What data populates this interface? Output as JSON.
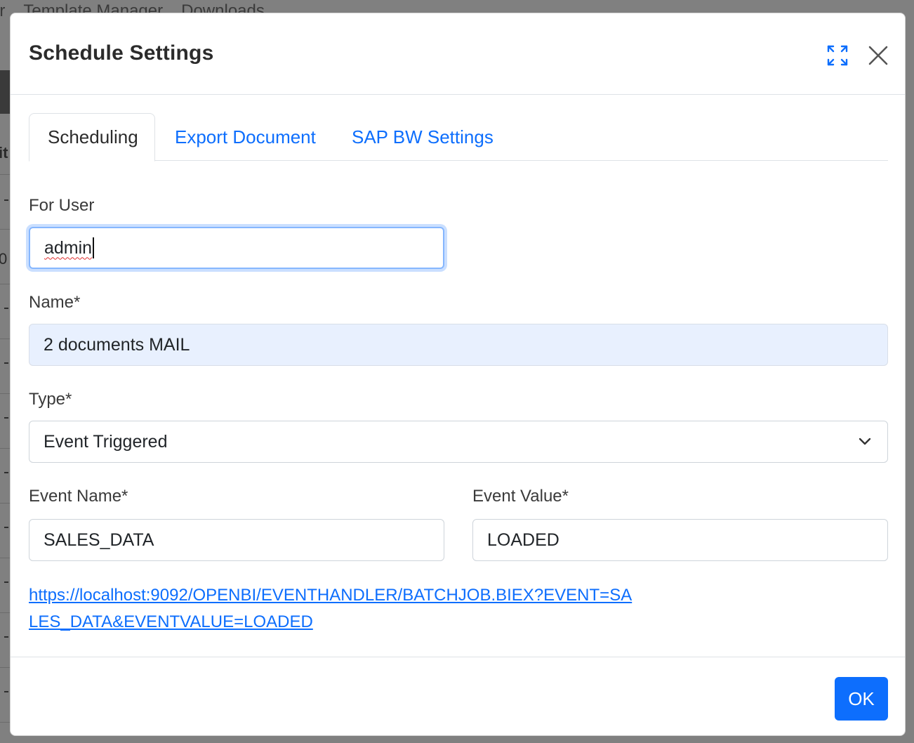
{
  "background": {
    "menu_items": [
      "er",
      "Template Manager",
      "Downloads"
    ],
    "edge_chars": [
      "it",
      "0"
    ]
  },
  "modal": {
    "title": "Schedule Settings",
    "expand_icon": "expand-icon",
    "close_icon": "close-icon"
  },
  "tabs": [
    {
      "label": "Scheduling",
      "active": true
    },
    {
      "label": "Export Document",
      "active": false
    },
    {
      "label": "SAP BW Settings",
      "active": false
    }
  ],
  "form": {
    "for_user": {
      "label": "For User",
      "value": "admin"
    },
    "name": {
      "label": "Name*",
      "value": "2 documents MAIL"
    },
    "type": {
      "label": "Type*",
      "value": "Event Triggered"
    },
    "event_name": {
      "label": "Event Name*",
      "value": "SALES_DATA"
    },
    "event_value": {
      "label": "Event Value*",
      "value": "LOADED"
    },
    "event_url": "https://localhost:9092/OPENBI/EVENTHANDLER/BATCHJOB.BIEX?EVENT=SALES_DATA&EVENTVALUE=LOADED"
  },
  "footer": {
    "ok_label": "OK"
  },
  "colors": {
    "accent": "#0d6efd",
    "readonly_bg": "#e8f0fe",
    "overlay": "#808080"
  }
}
